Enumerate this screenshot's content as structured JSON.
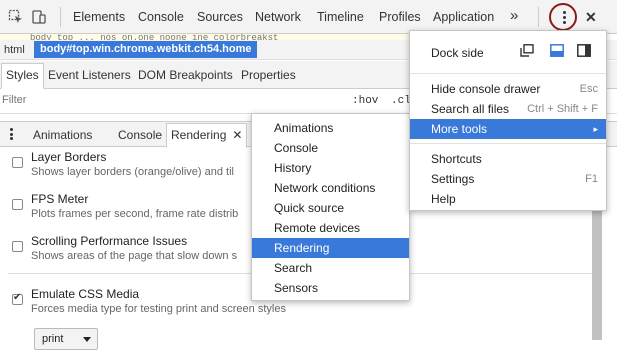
{
  "toolbar": {
    "tabs": [
      "Elements",
      "Console",
      "Sources",
      "Network",
      "Timeline",
      "Profiles",
      "Application"
    ],
    "overflow_label": "»",
    "close_label": "✕"
  },
  "page_snippet": "body   top   ...   nos on.one noone  ine   colorbreakst",
  "breadcrumb": {
    "html": "html",
    "selected": "body#top.win.chrome.webkit.ch54.home"
  },
  "styles_tabs": [
    "Styles",
    "Event Listeners",
    "DOM Breakpoints",
    "Properties"
  ],
  "filter": {
    "placeholder": "Filter",
    "hov": ":hov",
    "cls": ".cl"
  },
  "drawer": {
    "tabs": [
      "Animations",
      "Console"
    ],
    "active_tab": "Rendering",
    "close_label": "✕"
  },
  "rendering": {
    "options": [
      {
        "title": "Layer Borders",
        "desc": "Shows layer borders (orange/olive) and til",
        "checked": false
      },
      {
        "title": "FPS Meter",
        "desc": "Plots frames per second, frame rate distrib",
        "checked": false
      },
      {
        "title": "Scrolling Performance Issues",
        "desc": "Shows areas of the page that slow down s",
        "checked": false
      },
      {
        "title": "Emulate CSS Media",
        "desc": "Forces media type for testing print and screen styles",
        "checked": true
      }
    ],
    "media_value": "print"
  },
  "main_menu": {
    "dock_side_label": "Dock side",
    "items": [
      {
        "label": "Hide console drawer",
        "shortcut": "Esc"
      },
      {
        "label": "Search all files",
        "shortcut": "Ctrl + Shift + F"
      },
      {
        "label": "More tools",
        "shortcut": "▸"
      },
      {
        "label": "Shortcuts",
        "shortcut": ""
      },
      {
        "label": "Settings",
        "shortcut": "F1"
      },
      {
        "label": "Help",
        "shortcut": ""
      }
    ]
  },
  "more_tools_menu": {
    "items": [
      "Animations",
      "Console",
      "History",
      "Network conditions",
      "Quick source",
      "Remote devices",
      "Rendering",
      "Search",
      "Sensors"
    ],
    "highlighted": "Rendering"
  },
  "colors": {
    "highlight": "#3879d9",
    "menu_button_ring": "#8b1a1a"
  }
}
